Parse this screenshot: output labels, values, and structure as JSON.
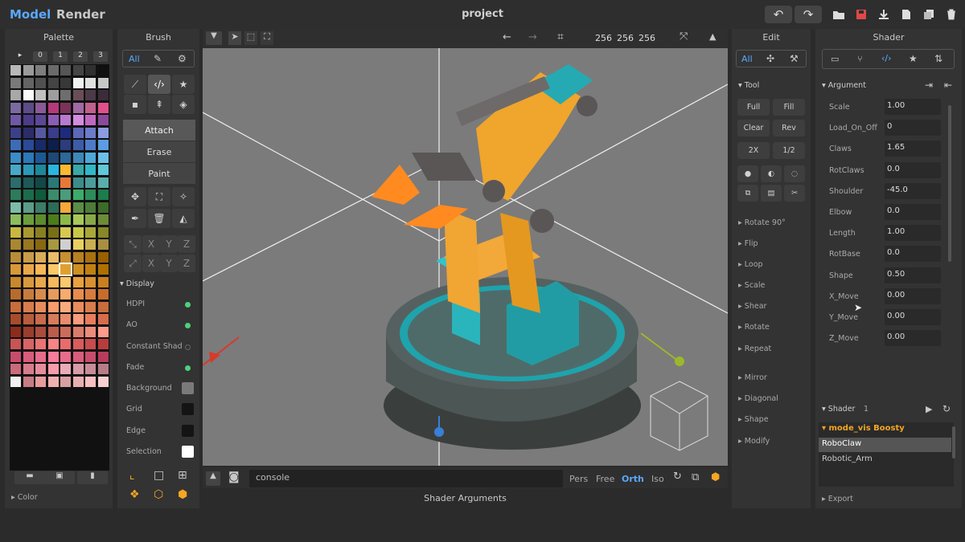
{
  "app": {
    "title": "project",
    "modes": [
      "Model",
      "Render"
    ]
  },
  "palette": {
    "title": "Palette",
    "tabs": [
      "▸",
      "0",
      "1",
      "2",
      "3"
    ],
    "footer": "Color",
    "colors": [
      [
        "#b8b8b8",
        "#9a9a9a",
        "#7e7e7e",
        "#6a6a6a",
        "#565656",
        "#444",
        "#303030",
        "#101010"
      ],
      [
        "#7a7a7a",
        "#646464",
        "#505050",
        "#444",
        "#383838",
        "#f0f0f0",
        "#e0e0e0",
        "#c8c8c8"
      ],
      [
        "#a8a8a8",
        "#fafafa",
        "#c0c0c0",
        "#9e9e9e",
        "#6e6e6e",
        "#6a4e56",
        "#4c3a48",
        "#3a2c38"
      ],
      [
        "#7a6aa0",
        "#5c4c88",
        "#8a5a96",
        "#b43a7a",
        "#7a3458",
        "#a06aa2",
        "#c0608c",
        "#e0508a"
      ],
      [
        "#7058a8",
        "#4c3c8a",
        "#5c4896",
        "#8c5cb4",
        "#b87ad0",
        "#d48ce0",
        "#c068c0",
        "#8a4a9a"
      ],
      [
        "#3c4088",
        "#2c2c68",
        "#5858a0",
        "#3a3c8c",
        "#1e2a7c",
        "#5c68b8",
        "#6c7cc8",
        "#8c9ce0"
      ],
      [
        "#3c6cb8",
        "#2a4a98",
        "#182a6a",
        "#0e1e4c",
        "#2c3c7c",
        "#3c5ca8",
        "#4c7cc8",
        "#5c9ce0"
      ],
      [
        "#3c8cc8",
        "#2c78b8",
        "#1c5898",
        "#1e4878",
        "#2c6898",
        "#3c88b8",
        "#4ca8d8",
        "#6cc0e8"
      ],
      [
        "#48a8c8",
        "#2c98b8",
        "#1c8898",
        "#2ab4e0",
        "#fcb830",
        "#38a8a8",
        "#30b8c8",
        "#60c8d8"
      ],
      [
        "#2c6c6c",
        "#1e5858",
        "#124848",
        "#2a7878",
        "#e87838",
        "#3c8c8c",
        "#4c9c9c",
        "#5cacac"
      ],
      [
        "#2c7c5c",
        "#1c6c4c",
        "#0e5c3c",
        "#3c8c6c",
        "#4c9c7c",
        "#3cac6c",
        "#2c8c5c",
        "#1c7c4c"
      ],
      [
        "#7cbca8",
        "#5c9c88",
        "#3c7c68",
        "#2c6c58",
        "#f8a838",
        "#5c8c48",
        "#4c7c38",
        "#3c6c28"
      ],
      [
        "#8cbc5c",
        "#6c9c3c",
        "#5c8c2c",
        "#4c7c1c",
        "#8cb848",
        "#a8c858",
        "#88a848",
        "#6c8c38"
      ],
      [
        "#c8b840",
        "#a89830",
        "#888020",
        "#787018",
        "#d8c850",
        "#c8c848",
        "#a8a838",
        "#888828"
      ],
      [
        "#a88830",
        "#987820",
        "#886810",
        "#a89840",
        "#d0d0d0",
        "#e8d060",
        "#c8b050",
        "#a89040"
      ],
      [
        "#b88c38",
        "#c89c48",
        "#d8ac58",
        "#e8bc68",
        "#c89030",
        "#b88020",
        "#a87010",
        "#986000"
      ],
      [
        "#d89838",
        "#e8a848",
        "#f8b858",
        "#fcc868",
        "#e0a030",
        "#d09020",
        "#c08010",
        "#b07000"
      ],
      [
        "#c8882c",
        "#d8983c",
        "#e8a84c",
        "#f8b85c",
        "#fcc86c",
        "#e8a040",
        "#d89030",
        "#c88020"
      ],
      [
        "#b86c2c",
        "#c87c3c",
        "#d88c4c",
        "#e89c5c",
        "#f8ac6c",
        "#e88c4c",
        "#d87c3c",
        "#c86c2c"
      ],
      [
        "#c86c3c",
        "#d87c4c",
        "#e88c5c",
        "#f89c6c",
        "#f8ac7c",
        "#e88c5c",
        "#d87c4c",
        "#c86c3c"
      ],
      [
        "#a84c2c",
        "#b85c3c",
        "#c86c4c",
        "#d87c5c",
        "#e88c6c",
        "#f89c7c",
        "#e87c5c",
        "#d86c4c"
      ],
      [
        "#8c2c1c",
        "#9c3c2c",
        "#ac4c3c",
        "#bc5c4c",
        "#cc6c5c",
        "#dc7c6c",
        "#ec8c7c",
        "#fc9c8c"
      ],
      [
        "#c85454",
        "#d86464",
        "#e87474",
        "#f88484",
        "#e86c6c",
        "#d85c5c",
        "#c84c4c",
        "#b83c3c"
      ],
      [
        "#c84c6c",
        "#d85c7c",
        "#e86c8c",
        "#f87c9c",
        "#e86c8c",
        "#d85c7c",
        "#c84c6c",
        "#b83c5c"
      ],
      [
        "#c86c7c",
        "#d87c8c",
        "#e88c9c",
        "#f89cac",
        "#e8acb8",
        "#d89ca8",
        "#c88c98",
        "#b87c88"
      ],
      [
        "#f0f0f0",
        "#c87c84",
        "#e89c9c",
        "#f0b0b0",
        "#d8a0a0",
        "#e8b0b0",
        "#f8c0c0",
        "#f8d0d0"
      ]
    ]
  },
  "brush": {
    "title": "Brush",
    "all_label": "All",
    "actions": [
      "Attach",
      "Erase",
      "Paint"
    ],
    "axis_row1": [
      "X",
      "Y",
      "Z"
    ],
    "axis_row2": [
      "X",
      "Y",
      "Z"
    ]
  },
  "display": {
    "title": "Display",
    "items": [
      {
        "label": "HDPI",
        "on": true
      },
      {
        "label": "AO",
        "on": true
      },
      {
        "label": "Constant Shad",
        "on": false
      },
      {
        "label": "Fade",
        "on": true
      }
    ],
    "colors": [
      {
        "label": "Background",
        "color": "#7a7a7a"
      },
      {
        "label": "Grid",
        "color": "#141414"
      },
      {
        "label": "Edge",
        "color": "#141414"
      },
      {
        "label": "Selection",
        "color": "#ffffff"
      }
    ]
  },
  "viewport": {
    "size": [
      "256",
      "256",
      "256"
    ],
    "console_placeholder": "console",
    "views": [
      "Pers",
      "Free",
      "Orth",
      "Iso"
    ],
    "active_view": "Orth",
    "footer": "Shader Arguments"
  },
  "edit": {
    "title": "Edit",
    "all_label": "All",
    "tool_label": "Tool",
    "buttons": [
      [
        "Full",
        "Fill"
      ],
      [
        "Clear",
        "Rev"
      ],
      [
        "2X",
        "1/2"
      ]
    ],
    "menu": [
      "Rotate 90°",
      "Flip",
      "Loop",
      "Scale",
      "Shear",
      "Rotate",
      "Repeat",
      "Mirror",
      "Diagonal",
      "Shape",
      "Modify"
    ]
  },
  "shader": {
    "title": "Shader",
    "argument_label": "Argument",
    "args": [
      {
        "name": "Scale",
        "value": "1.00"
      },
      {
        "name": "Load_On_Off",
        "value": "0"
      },
      {
        "name": "Claws",
        "value": "1.65"
      },
      {
        "name": "RotClaws",
        "value": "0.0"
      },
      {
        "name": "Shoulder",
        "value": "-45.0"
      },
      {
        "name": "Elbow",
        "value": "0.0"
      },
      {
        "name": "Length",
        "value": "1.00"
      },
      {
        "name": "RotBase",
        "value": "0.0"
      },
      {
        "name": "Shape",
        "value": "0.50"
      },
      {
        "name": "X_Move",
        "value": "0.00"
      },
      {
        "name": "Y_Move",
        "value": "0.00"
      },
      {
        "name": "Z_Move",
        "value": "0.00"
      }
    ],
    "shader_label": "Shader",
    "shader_count": "1",
    "folder": "mode_vis Boosty",
    "files": [
      "RoboClaw",
      "Robotic_Arm"
    ],
    "selected": "RoboClaw",
    "export_label": "Export"
  },
  "accent": "#5aa8ff"
}
